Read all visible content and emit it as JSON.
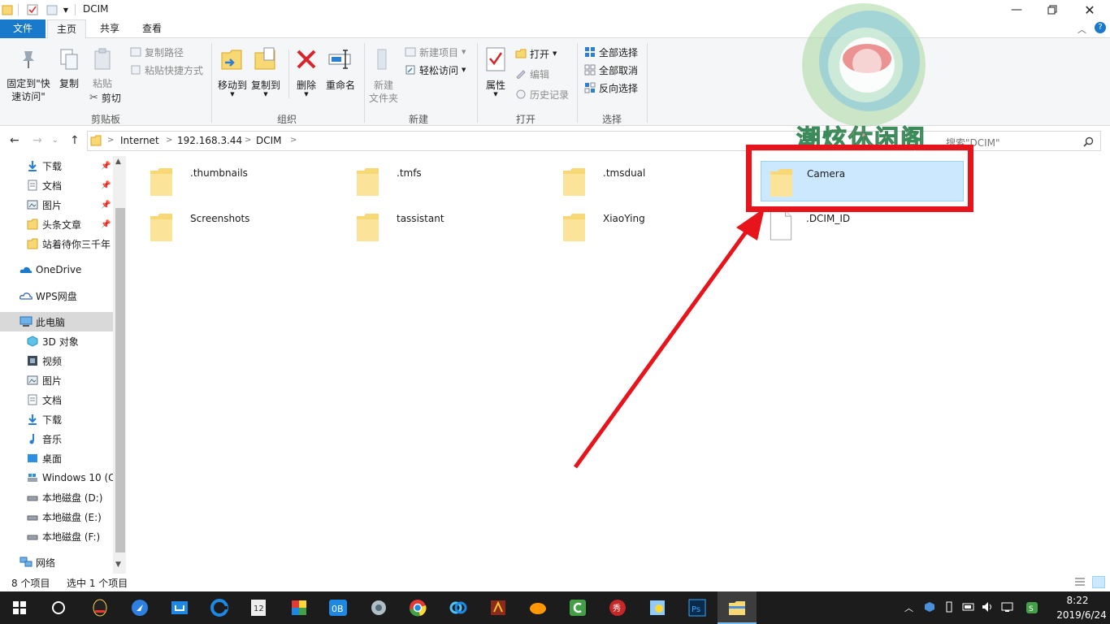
{
  "window": {
    "title": "DCIM",
    "icons": [
      "folder-icon",
      "properties-icon",
      "new-folder-icon",
      "dropdown-icon"
    ],
    "controls": [
      "minimize-icon",
      "maximize-icon",
      "close-icon"
    ]
  },
  "tabs": [
    {
      "label": "文件"
    },
    {
      "label": "主页"
    },
    {
      "label": "共享"
    },
    {
      "label": "查看"
    }
  ],
  "ribbon": {
    "clipboard": {
      "pin_line1": "固定到\"快",
      "pin_line2": "速访问\"",
      "copy": "复制",
      "paste": "粘贴",
      "copy_path": "复制路径",
      "paste_shortcut": "粘贴快捷方式",
      "cut": "剪切",
      "group": "剪贴板"
    },
    "organize": {
      "move_to": "移动到",
      "copy_to": "复制到",
      "delete": "删除",
      "rename": "重命名",
      "group": "组织"
    },
    "new": {
      "new_folder_line1": "新建",
      "new_folder_line2": "文件夹",
      "new_item": "新建项目",
      "easy_access": "轻松访问",
      "group": "新建"
    },
    "open": {
      "properties": "属性",
      "open": "打开",
      "edit": "编辑",
      "history": "历史记录",
      "group": "打开"
    },
    "select": {
      "select_all": "全部选择",
      "select_none": "全部取消",
      "invert": "反向选择",
      "group": "选择"
    }
  },
  "address": {
    "crumbs": [
      "Internet",
      "192.168.3.44",
      "DCIM"
    ],
    "search_placeholder": "搜索\"DCIM\""
  },
  "nav": {
    "quick": [
      {
        "label": "下载",
        "icon": "download-icon",
        "pinned": true
      },
      {
        "label": "文档",
        "icon": "document-icon",
        "pinned": true
      },
      {
        "label": "图片",
        "icon": "picture-icon",
        "pinned": true
      },
      {
        "label": "头条文章",
        "icon": "folder-icon",
        "pinned": true
      },
      {
        "label": "站着待你三千年",
        "icon": "folder-icon",
        "pinned": false
      }
    ],
    "onedrive": "OneDrive",
    "wps": "WPS网盘",
    "thispc": "此电脑",
    "pc_items": [
      {
        "label": "3D 对象",
        "icon": "3d-objects-icon"
      },
      {
        "label": "视频",
        "icon": "video-icon"
      },
      {
        "label": "图片",
        "icon": "picture-icon"
      },
      {
        "label": "文档",
        "icon": "document-icon"
      },
      {
        "label": "下载",
        "icon": "download-icon"
      },
      {
        "label": "音乐",
        "icon": "music-icon"
      },
      {
        "label": "桌面",
        "icon": "desktop-icon"
      },
      {
        "label": "Windows 10 (C",
        "icon": "windows-drive-icon"
      },
      {
        "label": "本地磁盘 (D:)",
        "icon": "drive-icon"
      },
      {
        "label": "本地磁盘 (E:)",
        "icon": "drive-icon"
      },
      {
        "label": "本地磁盘 (F:)",
        "icon": "drive-icon"
      }
    ],
    "network": "网络"
  },
  "files": [
    {
      "name": ".thumbnails",
      "type": "folder",
      "selected": false
    },
    {
      "name": ".tmfs",
      "type": "folder",
      "selected": false
    },
    {
      "name": ".tmsdual",
      "type": "folder",
      "selected": false
    },
    {
      "name": "Camera",
      "type": "folder",
      "selected": true
    },
    {
      "name": "Screenshots",
      "type": "folder",
      "selected": false
    },
    {
      "name": "tassistant",
      "type": "folder",
      "selected": false
    },
    {
      "name": "XiaoYing",
      "type": "folder",
      "selected": false
    },
    {
      "name": ".DCIM_ID",
      "type": "file",
      "selected": false
    }
  ],
  "status": {
    "count": "8 个项目",
    "selected": "选中 1 个项目"
  },
  "watermark": {
    "text": "潮炫休闲阁"
  },
  "annotation": {
    "color": "#e8141b"
  },
  "taskbar": {
    "apps": [
      "qq-icon",
      "feishu-icon",
      "thunder-icon",
      "edge-icon",
      "calculator-icon",
      "office-icon",
      "ob-icon",
      "tool-icon",
      "chrome-icon",
      "baidu-netdisk-icon",
      "game-icon",
      "fish-icon",
      "camtasia-icon",
      "meitu-icon",
      "paint-icon",
      "photoshop-icon",
      "explorer-icon"
    ],
    "time": "8:22",
    "date": "2019/6/24"
  },
  "colors": {
    "accent": "#1979ca",
    "selection": "#cce8ff",
    "folder": "#f8d775"
  }
}
